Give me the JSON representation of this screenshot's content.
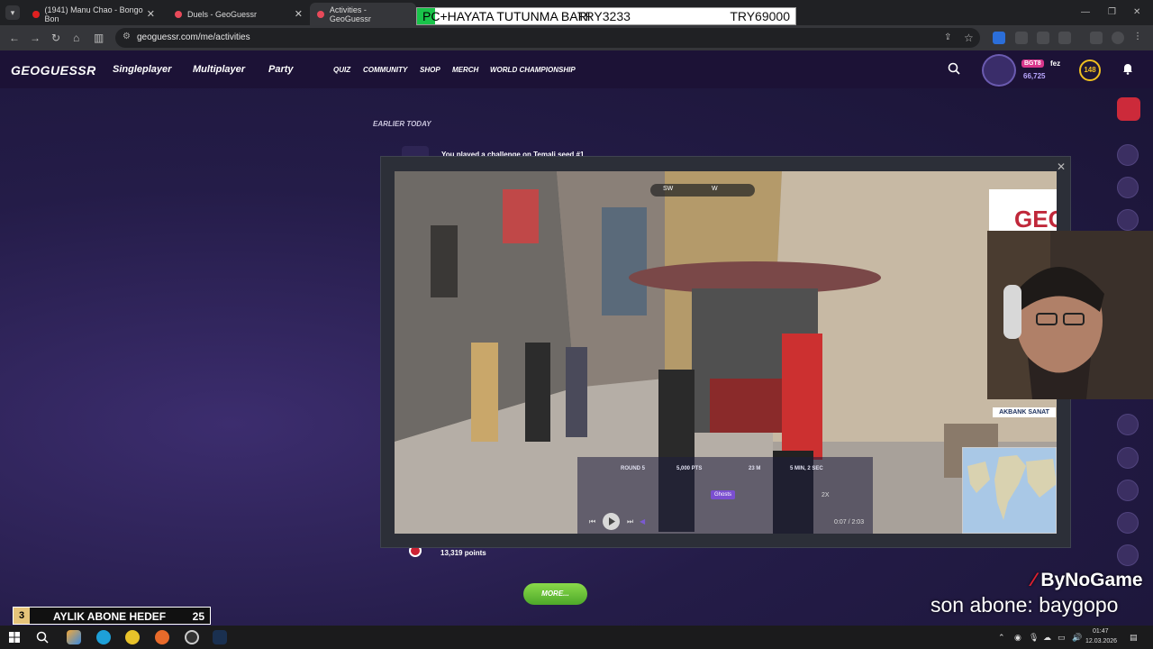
{
  "browser": {
    "tabs": [
      {
        "title": "(1941) Manu Chao - Bongo Bon",
        "active": false,
        "favicon_color": "#e02020"
      },
      {
        "title": "Duels - GeoGuessr",
        "active": false,
        "favicon_color": "#e84a5a"
      },
      {
        "title": "Activities - GeoGuessr",
        "active": true,
        "favicon_color": "#e84a5a"
      }
    ],
    "url": "geoguessr.com/me/activities"
  },
  "donation_bar": {
    "label": "PC+HAYATA TUTUNMA BARI",
    "current": "TRY3233",
    "goal": "TRY69000",
    "progress": 0.047
  },
  "geoguessr": {
    "logo": "GEOGUESSR",
    "nav": {
      "singleplayer": "Singleplayer",
      "multiplayer": "Multiplayer",
      "party": "Party",
      "quiz": "QUIZ",
      "community": "COMMUNITY",
      "shop": "SHOP",
      "merch": "MERCH",
      "world_championship": "WORLD CHAMPIONSHIP"
    },
    "user": {
      "badge": "BGT8",
      "name": "fez",
      "coins": "66,725",
      "level": "148"
    },
    "section_heading": "EARLIER TODAY",
    "activity_text": "You played a challenge on Temali seed #1",
    "points": "13,319 points",
    "more_button": "MORE..."
  },
  "replay": {
    "compass": {
      "left": "SW",
      "right": "W"
    },
    "stats": {
      "round": "ROUND 5",
      "points": "5,000 PTS",
      "distance": "23 M",
      "time": "5 MIN, 2 SEC"
    },
    "chip": "Ghosts",
    "speed": "2X",
    "time_display": "0:07 / 2:03",
    "shop_signs": [
      "GEO",
      "AKBANK SANAT"
    ]
  },
  "stream_overlay": {
    "sub_goal": {
      "number": "3",
      "label": "AYLIK ABONE HEDEF",
      "goal": "25"
    },
    "brand": "ByNoGame",
    "last_sub": "son abone: baygopo"
  },
  "taskbar": {
    "time": "01:47",
    "date": "12.03.2026"
  }
}
